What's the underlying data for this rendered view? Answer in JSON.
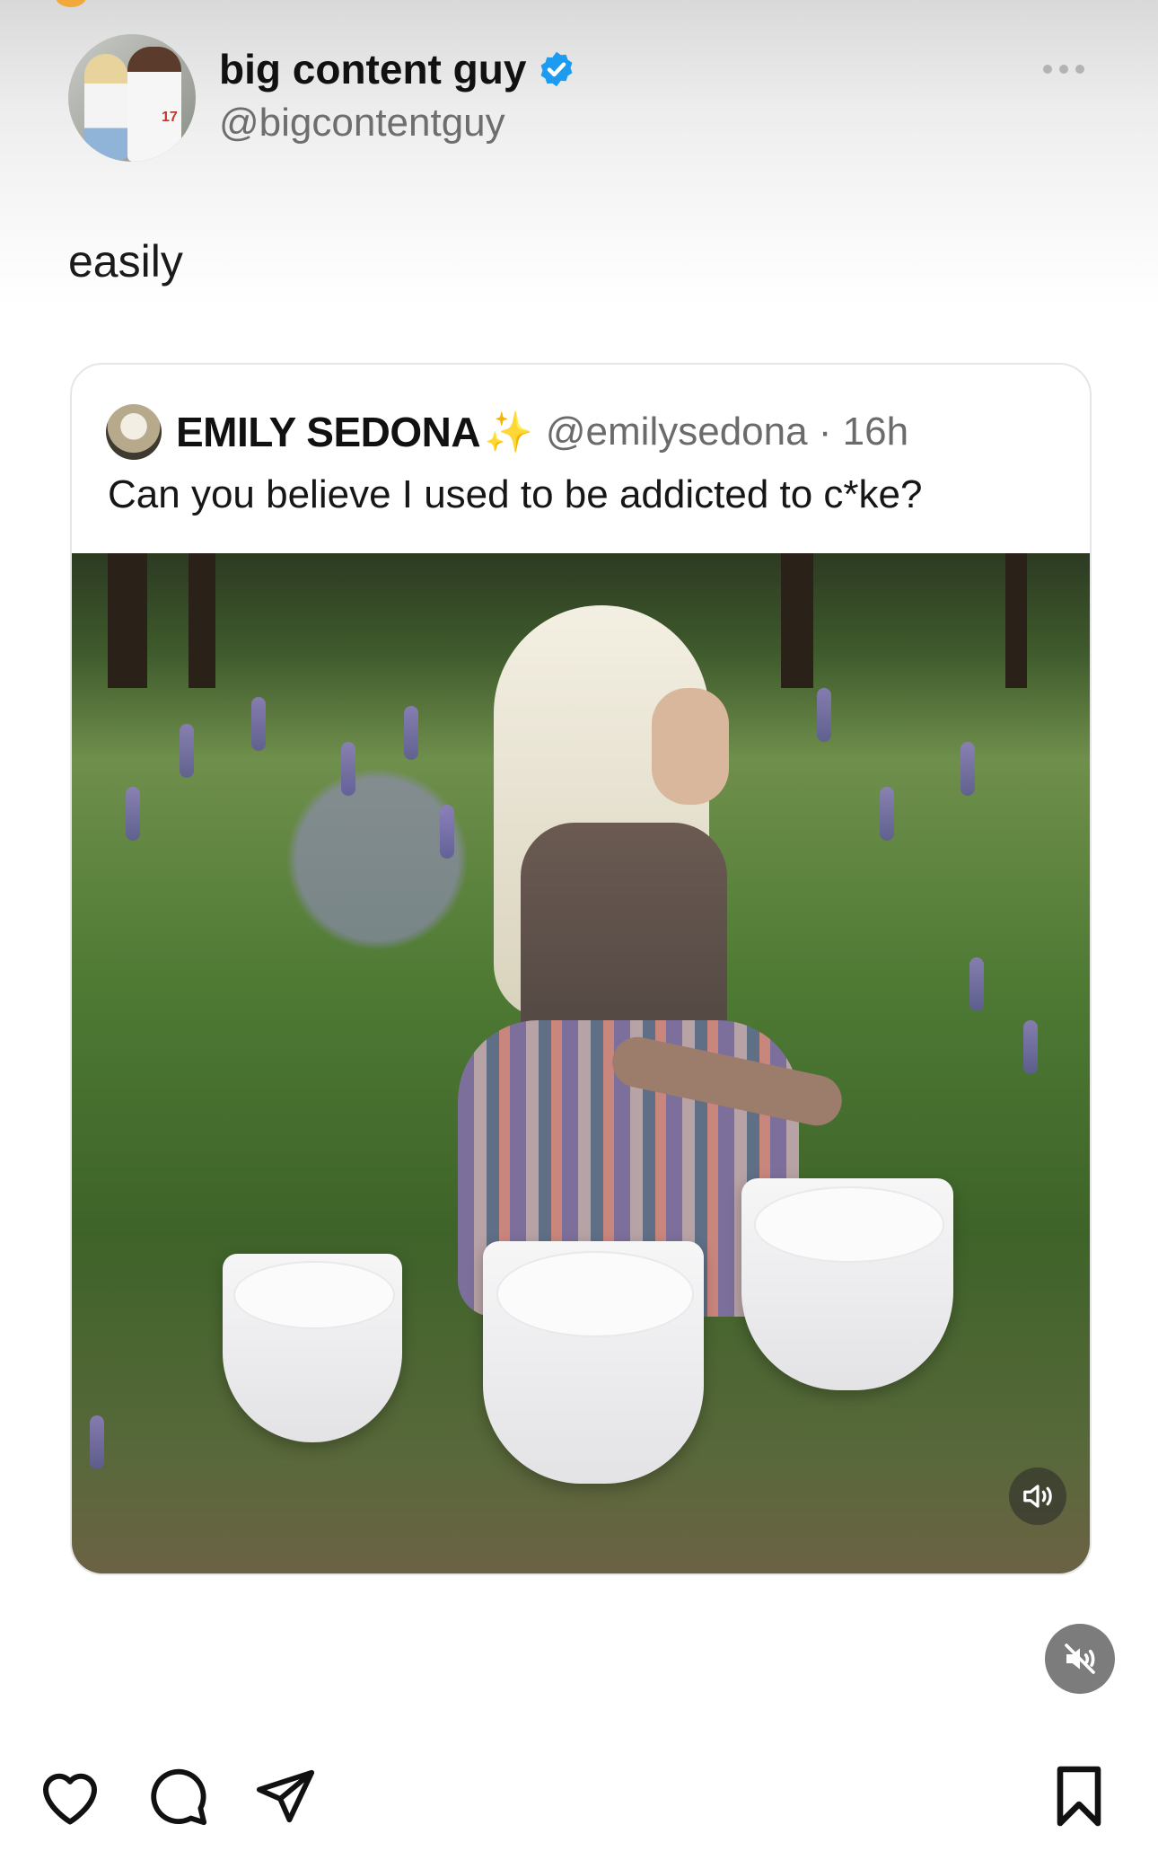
{
  "post": {
    "display_name": "big content guy",
    "username": "@bigcontentguy",
    "verified": true,
    "text": "easily",
    "avatar_number": "17"
  },
  "quoted_post": {
    "display_name": "EMILY SEDONA",
    "name_emoji": "✨",
    "handle_time": "@emilysedona · 16h",
    "text": "Can you believe I used to be addicted to c*ke?",
    "media": {
      "type": "video",
      "sound": "muted"
    }
  },
  "icons": {
    "verified": "verified-badge-icon",
    "more": "more-options-icon",
    "sound": "speaker-icon",
    "mute": "muted-speaker-icon",
    "like": "heart-icon",
    "comment": "comment-bubble-icon",
    "share": "send-icon",
    "save": "bookmark-icon"
  },
  "colors": {
    "verified_blue": "#1d9bf0",
    "username_gray": "#6e6e6e",
    "sparkle_yellow": "#f3c43b"
  }
}
